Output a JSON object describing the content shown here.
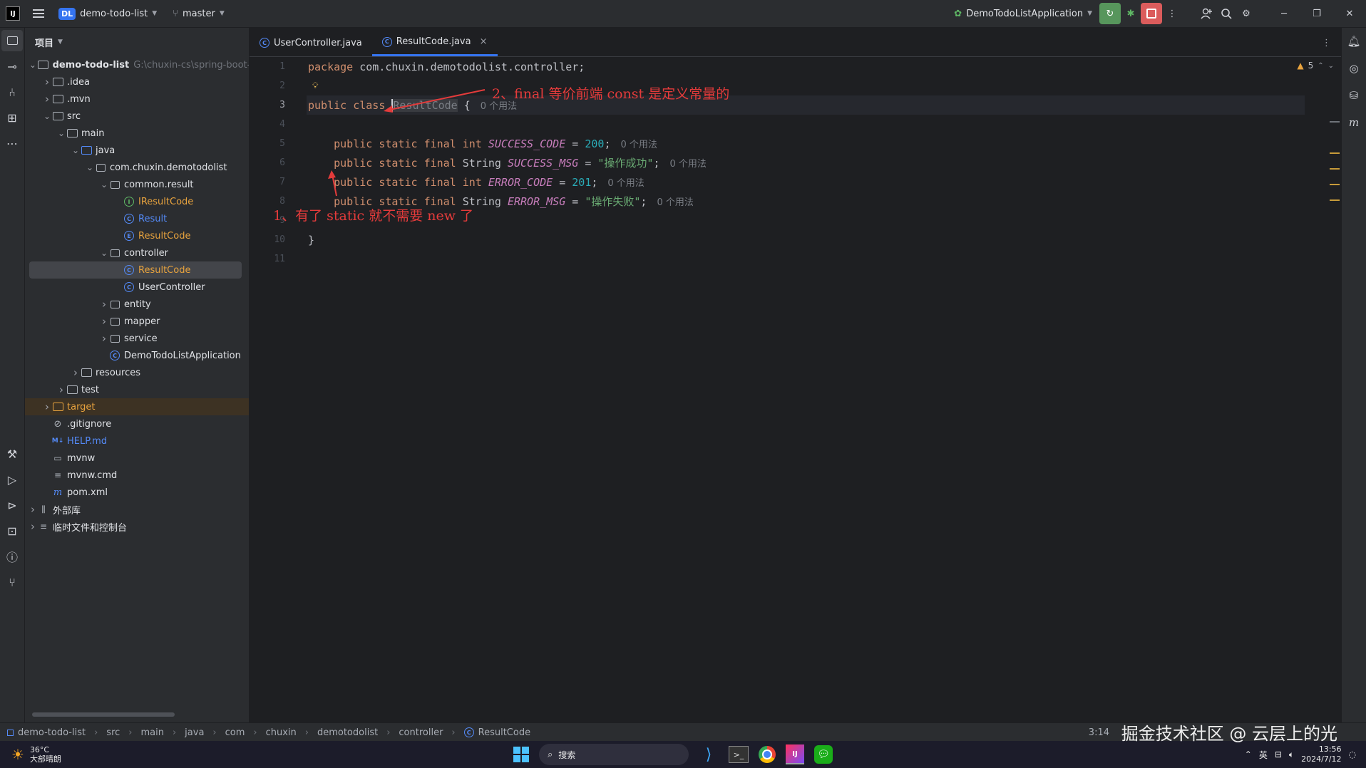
{
  "titlebar": {
    "project_badge": "DL",
    "project_name": "demo-todo-list",
    "branch": "master",
    "run_config": "DemoTodoListApplication"
  },
  "project_panel": {
    "title": "项目",
    "tree": [
      {
        "label": "demo-todo-list",
        "extra": "G:\\chuxin-cs\\spring-boot-",
        "indent": 0,
        "chev": "v",
        "icon": "folder",
        "bold": true
      },
      {
        "label": ".idea",
        "indent": 1,
        "chev": ">",
        "icon": "folder"
      },
      {
        "label": ".mvn",
        "indent": 1,
        "chev": ">",
        "icon": "folder"
      },
      {
        "label": "src",
        "indent": 1,
        "chev": "v",
        "icon": "folder"
      },
      {
        "label": "main",
        "indent": 2,
        "chev": "v",
        "icon": "folder"
      },
      {
        "label": "java",
        "indent": 3,
        "chev": "v",
        "icon": "folder-blue"
      },
      {
        "label": "com.chuxin.demotodolist",
        "indent": 4,
        "chev": "v",
        "icon": "package"
      },
      {
        "label": "common.result",
        "indent": 5,
        "chev": "v",
        "icon": "package"
      },
      {
        "label": "IResultCode",
        "indent": 6,
        "chev": "",
        "icon": "interface",
        "color": "orange"
      },
      {
        "label": "Result",
        "indent": 6,
        "chev": "",
        "icon": "class",
        "color": "blue"
      },
      {
        "label": "ResultCode",
        "indent": 6,
        "chev": "",
        "icon": "enum",
        "color": "orange"
      },
      {
        "label": "controller",
        "indent": 5,
        "chev": "v",
        "icon": "package"
      },
      {
        "label": "ResultCode",
        "indent": 6,
        "chev": "",
        "icon": "class",
        "color": "orange",
        "selected": true
      },
      {
        "label": "UserController",
        "indent": 6,
        "chev": "",
        "icon": "class"
      },
      {
        "label": "entity",
        "indent": 5,
        "chev": ">",
        "icon": "package"
      },
      {
        "label": "mapper",
        "indent": 5,
        "chev": ">",
        "icon": "package"
      },
      {
        "label": "service",
        "indent": 5,
        "chev": ">",
        "icon": "package"
      },
      {
        "label": "DemoTodoListApplication",
        "indent": 5,
        "chev": "",
        "icon": "class"
      },
      {
        "label": "resources",
        "indent": 3,
        "chev": ">",
        "icon": "folder"
      },
      {
        "label": "test",
        "indent": 2,
        "chev": ">",
        "icon": "folder"
      },
      {
        "label": "target",
        "indent": 1,
        "chev": ">",
        "icon": "folder-orange",
        "color": "orange",
        "target": true
      },
      {
        "label": ".gitignore",
        "indent": 1,
        "chev": "",
        "icon": "ignore"
      },
      {
        "label": "HELP.md",
        "indent": 1,
        "chev": "",
        "icon": "md",
        "color": "blue"
      },
      {
        "label": "mvnw",
        "indent": 1,
        "chev": "",
        "icon": "file"
      },
      {
        "label": "mvnw.cmd",
        "indent": 1,
        "chev": "",
        "icon": "lines"
      },
      {
        "label": "pom.xml",
        "indent": 1,
        "chev": "",
        "icon": "maven"
      },
      {
        "label": "外部库",
        "indent": 0,
        "chev": ">",
        "icon": "lib"
      },
      {
        "label": "临时文件和控制台",
        "indent": 0,
        "chev": ">",
        "icon": "scratch"
      }
    ]
  },
  "tabs": [
    {
      "label": "UserController.java",
      "active": false
    },
    {
      "label": "ResultCode.java",
      "active": true,
      "close": "×"
    }
  ],
  "editor": {
    "warnings": "5",
    "lines": [
      {
        "num": "1",
        "tokens": [
          [
            "kw",
            "package"
          ],
          [
            "",
            "com.chuxin.demotodolist.controller;"
          ]
        ]
      },
      {
        "num": "2",
        "tokens": [],
        "bulb": true
      },
      {
        "num": "3",
        "tokens": [
          [
            "kw",
            "public"
          ],
          [
            "kw",
            "class"
          ],
          [
            "cls",
            "ResultCode"
          ],
          [
            "",
            "{"
          ]
        ],
        "hint": "0 个用法",
        "current": true
      },
      {
        "num": "4",
        "tokens": []
      },
      {
        "num": "5",
        "tokens": [
          [
            "indent",
            "    "
          ],
          [
            "kw",
            "public"
          ],
          [
            "kw",
            "static"
          ],
          [
            "kw",
            "final"
          ],
          [
            "kw",
            "int"
          ],
          [
            "cn",
            "SUCCESS_CODE"
          ],
          [
            "",
            "="
          ],
          [
            "num",
            "200"
          ],
          [
            "",
            ";"
          ]
        ],
        "hint": "0 个用法"
      },
      {
        "num": "6",
        "tokens": [
          [
            "indent",
            "    "
          ],
          [
            "kw",
            "public"
          ],
          [
            "kw",
            "static"
          ],
          [
            "kw",
            "final"
          ],
          [
            "",
            "String"
          ],
          [
            "cn",
            "SUCCESS_MSG"
          ],
          [
            "",
            "="
          ],
          [
            "str",
            "\"操作成功\""
          ],
          [
            "",
            ";"
          ]
        ],
        "hint": "0 个用法"
      },
      {
        "num": "7",
        "tokens": [
          [
            "indent",
            "    "
          ],
          [
            "kw",
            "public"
          ],
          [
            "kw",
            "static"
          ],
          [
            "kw",
            "final"
          ],
          [
            "kw",
            "int"
          ],
          [
            "cn",
            "ERROR_CODE"
          ],
          [
            "",
            "="
          ],
          [
            "num",
            "201"
          ],
          [
            "",
            ";"
          ]
        ],
        "hint": "0 个用法"
      },
      {
        "num": "8",
        "tokens": [
          [
            "indent",
            "    "
          ],
          [
            "kw",
            "public"
          ],
          [
            "kw",
            "static"
          ],
          [
            "kw",
            "final"
          ],
          [
            "",
            "String"
          ],
          [
            "cn",
            "ERROR_MSG"
          ],
          [
            "",
            "="
          ],
          [
            "str",
            "\"操作失败\""
          ],
          [
            "",
            ";"
          ]
        ],
        "hint": "0 个用法"
      },
      {
        "num": "9",
        "tokens": []
      },
      {
        "num": "10",
        "tokens": [
          [
            "",
            "}"
          ]
        ]
      },
      {
        "num": "11",
        "tokens": []
      }
    ]
  },
  "annotations": {
    "note1": "1、有了 static 就不需要 new 了",
    "note2": "2、final 等价前端 const 是定义常量的"
  },
  "breadcrumb": [
    "demo-todo-list",
    "src",
    "main",
    "java",
    "com",
    "chuxin",
    "demotodolist",
    "controller",
    "ResultCode"
  ],
  "status": {
    "position": "3:14"
  },
  "taskbar": {
    "weather_temp": "36°C",
    "weather_desc": "大部晴朗",
    "search": "搜索",
    "ime": "英",
    "time": "13:56",
    "date": "2024/7/12"
  },
  "watermark": "掘金技术社区 @ 云层上的光",
  "colors": {
    "accent": "#3574f0",
    "annotation": "#e43b3b",
    "keyword": "#cf8e6d",
    "constant": "#c77dbb",
    "number": "#2aacb8",
    "string": "#6aab73"
  }
}
